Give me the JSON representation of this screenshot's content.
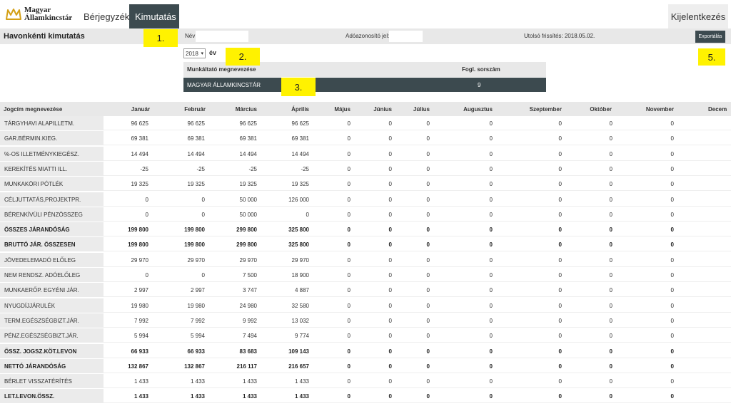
{
  "header": {
    "logo_line1": "Magyar",
    "logo_line2": "Államkincstár",
    "nav": [
      "Bérjegyzék",
      "Kimutatás"
    ],
    "logout": "Kijelentkezés"
  },
  "filter": {
    "title": "Havonkénti kimutatás",
    "name_label": "Név:",
    "name_value": "",
    "tax_label": "Adóazonosító jel:",
    "tax_value": "",
    "last_update": "Utolsó frissítés: 2018.05.02.",
    "export": "Exportálás"
  },
  "year": {
    "selected": "2018",
    "unit": "év"
  },
  "employer": {
    "col_name": "Munkáltató megnevezése",
    "col_number": "Fogl. sorszám",
    "name": "MAGYAR ÁLLAMKINCSTÁR",
    "number": "9"
  },
  "callouts": [
    "1.",
    "2.",
    "3.",
    "5."
  ],
  "table": {
    "headers": [
      "Jogcím megnevezése",
      "Január",
      "Február",
      "Március",
      "Április",
      "Május",
      "Június",
      "Július",
      "Augusztus",
      "Szeptember",
      "Október",
      "November",
      "Decem"
    ],
    "rows": [
      {
        "name": "TÁRGYHAVI ALAPILLETM.",
        "bold": false,
        "values": [
          "96 625",
          "96 625",
          "96 625",
          "96 625",
          "0",
          "0",
          "0",
          "0",
          "0",
          "0",
          "0"
        ]
      },
      {
        "name": "GAR.BÉRMIN.KIEG.",
        "bold": false,
        "values": [
          "69 381",
          "69 381",
          "69 381",
          "69 381",
          "0",
          "0",
          "0",
          "0",
          "0",
          "0",
          "0"
        ]
      },
      {
        "name": "%-OS ILLETMÉNYKIEGÉSZ.",
        "bold": false,
        "values": [
          "14 494",
          "14 494",
          "14 494",
          "14 494",
          "0",
          "0",
          "0",
          "0",
          "0",
          "0",
          "0"
        ]
      },
      {
        "name": "KEREKÍTÉS MIATTI ILL.",
        "bold": false,
        "values": [
          "-25",
          "-25",
          "-25",
          "-25",
          "0",
          "0",
          "0",
          "0",
          "0",
          "0",
          "0"
        ]
      },
      {
        "name": "MUNKAKÖRI PÓTLÉK",
        "bold": false,
        "values": [
          "19 325",
          "19 325",
          "19 325",
          "19 325",
          "0",
          "0",
          "0",
          "0",
          "0",
          "0",
          "0"
        ]
      },
      {
        "name": "CÉLJUTTATÁS,PROJEKTPR.",
        "bold": false,
        "values": [
          "0",
          "0",
          "50 000",
          "126 000",
          "0",
          "0",
          "0",
          "0",
          "0",
          "0",
          "0"
        ]
      },
      {
        "name": "BÉRENKÍVÜLI PÉNZÖSSZEG",
        "bold": false,
        "values": [
          "0",
          "0",
          "50 000",
          "0",
          "0",
          "0",
          "0",
          "0",
          "0",
          "0",
          "0"
        ]
      },
      {
        "name": "ÖSSZES JÁRANDÓSÁG",
        "bold": true,
        "values": [
          "199 800",
          "199 800",
          "299 800",
          "325 800",
          "0",
          "0",
          "0",
          "0",
          "0",
          "0",
          "0"
        ]
      },
      {
        "name": "BRUTTÓ JÁR. ÖSSZESEN",
        "bold": true,
        "values": [
          "199 800",
          "199 800",
          "299 800",
          "325 800",
          "0",
          "0",
          "0",
          "0",
          "0",
          "0",
          "0"
        ]
      },
      {
        "name": "JÖVEDELEMADÓ ELŐLEG",
        "bold": false,
        "values": [
          "29 970",
          "29 970",
          "29 970",
          "29 970",
          "0",
          "0",
          "0",
          "0",
          "0",
          "0",
          "0"
        ]
      },
      {
        "name": "NEM RENDSZ. ADÓELŐLEG",
        "bold": false,
        "values": [
          "0",
          "0",
          "7 500",
          "18 900",
          "0",
          "0",
          "0",
          "0",
          "0",
          "0",
          "0"
        ]
      },
      {
        "name": "MUNKAERŐP. EGYÉNI JÁR.",
        "bold": false,
        "values": [
          "2 997",
          "2 997",
          "3 747",
          "4 887",
          "0",
          "0",
          "0",
          "0",
          "0",
          "0",
          "0"
        ]
      },
      {
        "name": "NYUGDÍJJÁRULÉK",
        "bold": false,
        "values": [
          "19 980",
          "19 980",
          "24 980",
          "32 580",
          "0",
          "0",
          "0",
          "0",
          "0",
          "0",
          "0"
        ]
      },
      {
        "name": "TERM.EGÉSZSÉGBIZT.JÁR.",
        "bold": false,
        "values": [
          "7 992",
          "7 992",
          "9 992",
          "13 032",
          "0",
          "0",
          "0",
          "0",
          "0",
          "0",
          "0"
        ]
      },
      {
        "name": "PÉNZ.EGÉSZSÉGBIZT.JÁR.",
        "bold": false,
        "values": [
          "5 994",
          "5 994",
          "7 494",
          "9 774",
          "0",
          "0",
          "0",
          "0",
          "0",
          "0",
          "0"
        ]
      },
      {
        "name": "ÖSSZ. JOGSZ.KÖT.LEVON",
        "bold": true,
        "values": [
          "66 933",
          "66 933",
          "83 683",
          "109 143",
          "0",
          "0",
          "0",
          "0",
          "0",
          "0",
          "0"
        ]
      },
      {
        "name": "NETTÓ JÁRANDÓSÁG",
        "bold": true,
        "values": [
          "132 867",
          "132 867",
          "216 117",
          "216 657",
          "0",
          "0",
          "0",
          "0",
          "0",
          "0",
          "0"
        ]
      },
      {
        "name": "BÉRLET VISSZATÉRÍTÉS",
        "bold": false,
        "values": [
          "1 433",
          "1 433",
          "1 433",
          "1 433",
          "0",
          "0",
          "0",
          "0",
          "0",
          "0",
          "0"
        ]
      },
      {
        "name": "LET.LEVON.ÖSSZ.",
        "bold": true,
        "values": [
          "1 433",
          "1 433",
          "1 433",
          "1 433",
          "0",
          "0",
          "0",
          "0",
          "0",
          "0",
          "0"
        ]
      }
    ]
  }
}
